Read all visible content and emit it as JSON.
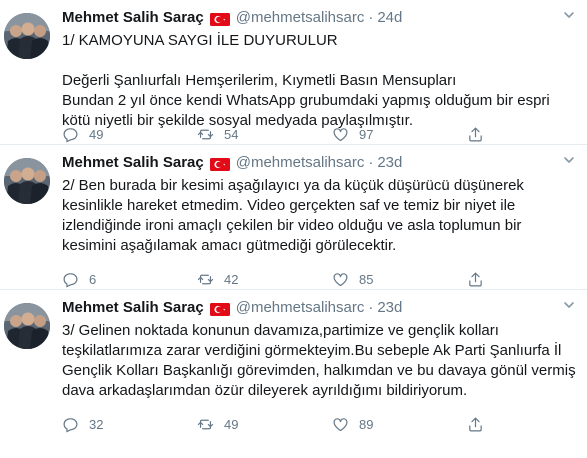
{
  "tweets": [
    {
      "name": "Mehmet Salih Saraç",
      "handle": "@mehmetsalihsarc",
      "dot": "·",
      "time": "24d",
      "text": "1/ KAMOYUNA SAYGI İLE DUYURULUR\n\nDeğerli Şanlıurfalı Hemşerilerim, Kıymetli Basın Mensupları\nBundan 2 yıl önce kendi WhatsApp grubumdaki yapmış olduğum bir espri kötü niyetli bir şekilde sosyal medyada paylaşılmıştır.",
      "replies": "49",
      "retweets": "54",
      "likes": "97"
    },
    {
      "name": "Mehmet Salih Saraç",
      "handle": "@mehmetsalihsarc",
      "dot": "·",
      "time": "23d",
      "text": "2/ Ben burada bir kesimi aşağılayıcı ya da küçük düşürücü düşünerek kesinlikle hareket etmedim. Video gerçekten saf ve temiz bir niyet ile izlendiğinde ironi amaçlı çekilen bir video olduğu ve asla toplumun bir kesimini aşağılamak amacı gütmediği görülecektir.",
      "replies": "6",
      "retweets": "42",
      "likes": "85"
    },
    {
      "name": "Mehmet Salih Saraç",
      "handle": "@mehmetsalihsarc",
      "dot": "·",
      "time": "23d",
      "text": "3/ Gelinen noktada konunun davamıza,partimize ve gençlik kolları teşkilatlarımıza zarar verdiğini görmekteyim.Bu sebeple Ak Parti Şanlıurfa İl Gençlik Kolları Başkanlığı görevimden, halkımdan ve bu davaya gönül vermiş dava arkadaşlarımdan özür dileyerek ayrıldığımı bildiriyorum.",
      "replies": "32",
      "retweets": "49",
      "likes": "89"
    }
  ],
  "icons": {
    "flag": "turkey-flag-icon",
    "more": "chevron-down-icon",
    "reply": "reply-icon",
    "retweet": "retweet-icon",
    "like": "heart-icon"
  },
  "colors": {
    "text": "#14171a",
    "secondary": "#657786",
    "divider": "#e6ecf0",
    "flag_red": "#e30a17"
  }
}
